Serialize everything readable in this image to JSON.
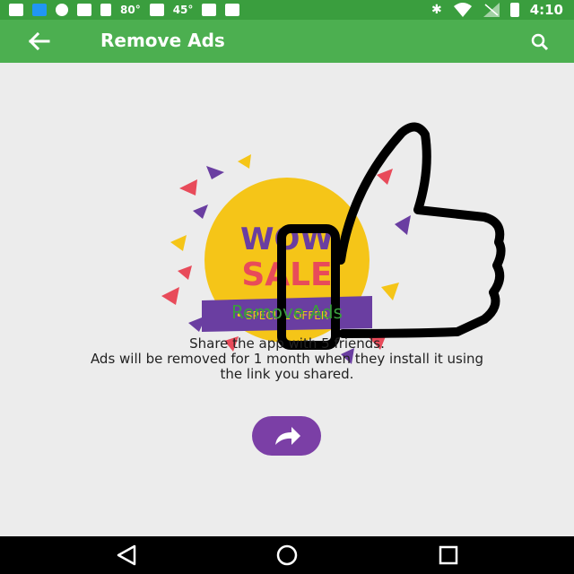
{
  "status_bar": {
    "temp1": "80°",
    "temp2": "45°",
    "time": "4:10"
  },
  "app_bar": {
    "title": "Remove Ads"
  },
  "promo": {
    "badge_line1": "WOW",
    "badge_line2": "SALE",
    "ribbon": "• SPECIAL OFFER •"
  },
  "main": {
    "heading": "Remove Ads",
    "desc_line1": "Share the app with 5 friends.",
    "desc_line2": "Ads will be removed for 1 month when they install it using",
    "desc_line3": "the link you shared."
  },
  "colors": {
    "app_bar": "#4caf50",
    "status_bar": "#3a9e3e",
    "accent_purple": "#7b3fa6",
    "heading_green": "#3a9e3e"
  },
  "icons": {
    "back": "arrow-left-icon",
    "search": "search-icon",
    "share": "share-arrow-icon",
    "nav_back": "triangle-back-icon",
    "nav_home": "circle-home-icon",
    "nav_recent": "square-recent-icon"
  }
}
